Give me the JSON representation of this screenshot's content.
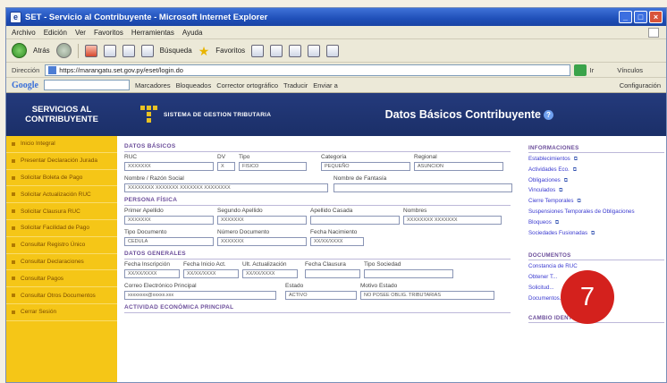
{
  "window": {
    "title": "SET - Servicio al Contribuyente - Microsoft Internet Explorer",
    "minimize": "_",
    "maximize": "□",
    "close": "×"
  },
  "menu": [
    "Archivo",
    "Edición",
    "Ver",
    "Favoritos",
    "Herramientas",
    "Ayuda"
  ],
  "toolbar": {
    "back": "Atrás",
    "search": "Búsqueda",
    "favorites": "Favoritos"
  },
  "address": {
    "label": "Dirección",
    "url": "https://marangatu.set.gov.py/eset/login.do",
    "go": "Ir",
    "links": "Vínculos"
  },
  "google": {
    "logo": "Google",
    "items": [
      "Marcadores",
      "Bloqueados",
      "Corrector ortográfico",
      "Traducir",
      "Enviar a"
    ],
    "config": "Configuración"
  },
  "header": {
    "brand_line1": "SERVICIOS AL",
    "brand_line2": "CONTRIBUYENTE",
    "system": "SISTEMA DE GESTION TRIBUTARIA",
    "page_title": "Datos Básicos Contribuyente",
    "help": "?"
  },
  "sidebar": [
    "Inicio Integral",
    "Presentar Declaración Jurada",
    "Solicitar Boleta de Pago",
    "Solicitar Actualización RUC",
    "Solicitar Clausura RUC",
    "Solicitar Facilidad de Pago",
    "Consultar Registro Único",
    "Consultar Declaraciones",
    "Consultar Pagos",
    "Consultar Otros Documentos",
    "Cerrar Sesión"
  ],
  "datos_basicos": {
    "title": "DATOS BÁSICOS",
    "ruc_label": "RUC",
    "ruc": "XXXXXXX",
    "dv_label": "DV",
    "dv": "X",
    "tipo_label": "Tipo",
    "tipo": "FISICO",
    "categoria_label": "Categoría",
    "categoria": "PEQUEÑO",
    "regional_label": "Regional",
    "regional": "ASUNCION",
    "nombre_label": "Nombre / Razón Social",
    "nombre": "XXXXXXXX XXXXXXX XXXXXXX XXXXXXXX",
    "fantasia_label": "Nombre de Fantasía",
    "fantasia": ""
  },
  "persona_fisica": {
    "title": "PERSONA FÍSICA",
    "primer_apellido_label": "Primer Apellido",
    "primer_apellido": "XXXXXXX",
    "segundo_apellido_label": "Segundo Apellido",
    "segundo_apellido": "XXXXXXX",
    "apellido_casada_label": "Apellido Casada",
    "apellido_casada": "",
    "nombres_label": "Nombres",
    "nombres": "XXXXXXXX XXXXXXX",
    "tipo_doc_label": "Tipo Documento",
    "tipo_doc": "CEDULA",
    "numero_doc_label": "Número Documento",
    "numero_doc": "XXXXXXX",
    "fecha_nac_label": "Fecha Nacimiento",
    "fecha_nac": "XX/XX/XXXX"
  },
  "datos_generales": {
    "title": "DATOS GENERALES",
    "fecha_inscripcion_label": "Fecha Inscripción",
    "fecha_inscripcion": "XX/XX/XXXX",
    "fecha_inicio_label": "Fecha Inicio Act.",
    "fecha_inicio": "XX/XX/XXXX",
    "ult_act_label": "Ult. Actualización",
    "ult_act": "XX/XX/XXXX",
    "fecha_clausura_label": "Fecha Clausura",
    "fecha_clausura": "",
    "tipo_sociedad_label": "Tipo Sociedad",
    "tipo_sociedad": "",
    "correo_label": "Correo Electrónico Principal",
    "correo": "xxxxxxxx@xxxxx.xxx",
    "estado_label": "Estado",
    "estado": "ACTIVO",
    "motivo_label": "Motivo Estado",
    "motivo": "NO POSEE OBLIG. TRIBUTARIAS"
  },
  "actividad": {
    "title": "ACTIVIDAD ECONÓMICA PRINCIPAL"
  },
  "informaciones": {
    "title": "INFORMACIONES",
    "items": [
      "Establecimientos",
      "Actividades Eco.",
      "Obligaciones",
      "Vinculados",
      "Cierre Temporales",
      "Suspensiones Temporales de Obligaciones",
      "Bloqueos",
      "Sociedades Fusionadas"
    ]
  },
  "documentos": {
    "title": "DOCUMENTOS",
    "items": [
      "Constancia de RUC",
      "Obtener T...",
      "Solicitud...",
      "Documentos..."
    ]
  },
  "cambio_identificador": {
    "title": "CAMBIO IDENTIFICADOR"
  },
  "badge": "7"
}
